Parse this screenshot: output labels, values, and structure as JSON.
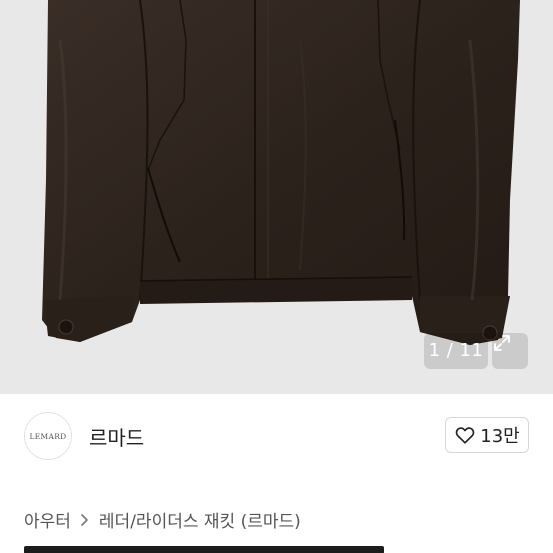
{
  "gallery": {
    "counter": "1 / 11",
    "image_name": "leather-jacket-photo",
    "background": "#e8e8e8",
    "expand_icon": "expand-icon"
  },
  "shop": {
    "logo_text": "LEMARD",
    "name": "르마드",
    "like_icon": "heart-outline-icon",
    "like_count": "13만"
  },
  "breadcrumb": {
    "category": "아우터",
    "separator_icon": "chevron-right-icon",
    "subcategory": "레더/라이더스 재킷 (르마드)"
  }
}
